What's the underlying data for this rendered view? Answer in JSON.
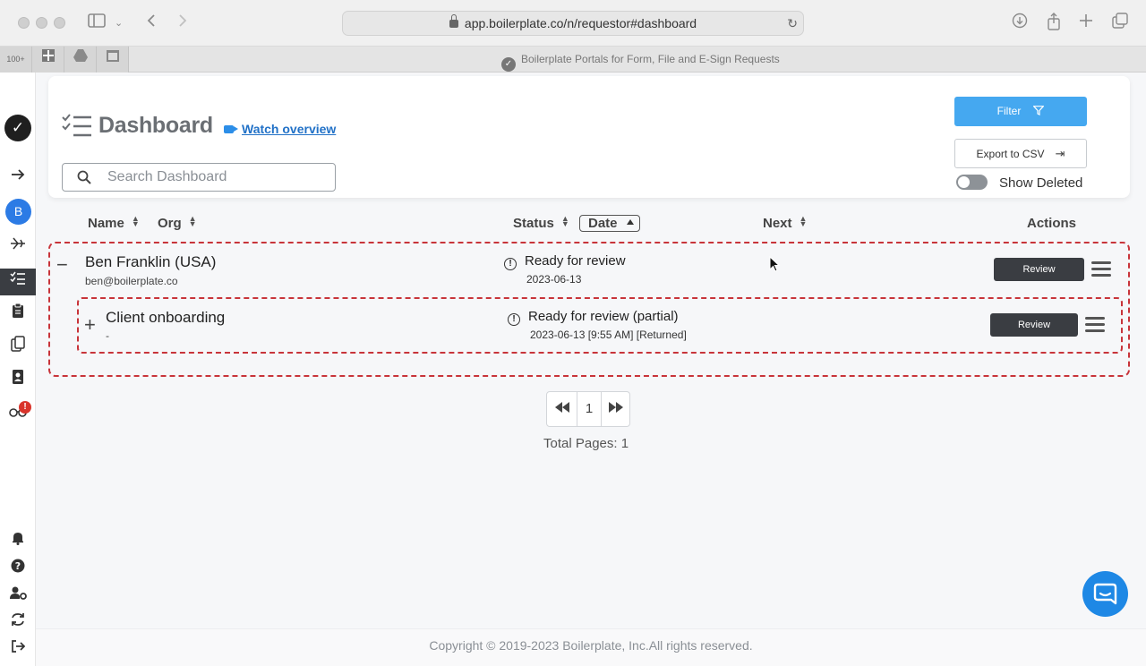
{
  "browser": {
    "url": "app.boilerplate.co/n/requestor#dashboard",
    "tab_title": "Boilerplate Portals for Form, File and E-Sign Requests",
    "pinned_tabs": [
      "100+",
      "ms",
      "drive",
      "31"
    ]
  },
  "header": {
    "title": "Dashboard",
    "watch_overview": "Watch overview",
    "search_placeholder": "Search Dashboard",
    "filter_label": "Filter",
    "export_label": "Export to CSV",
    "show_deleted_label": "Show Deleted",
    "show_deleted_on": false
  },
  "sidebar": {
    "avatar_initial": "B",
    "notification_badge": "!"
  },
  "columns": {
    "name": "Name",
    "org": "Org",
    "status": "Status",
    "date": "Date",
    "next": "Next",
    "actions": "Actions"
  },
  "rows": [
    {
      "expander": "−",
      "name": "Ben Franklin (USA)",
      "sub": "ben@boilerplate.co",
      "status": "Ready for review",
      "date": "2023-06-13",
      "action": "Review"
    },
    {
      "expander": "+",
      "name": "Client onboarding",
      "sub": "-",
      "status": "Ready for review (partial)",
      "date": "2023-06-13 [9:55 AM] [Returned]",
      "action": "Review"
    }
  ],
  "pagination": {
    "current_page": "1",
    "total_pages_text": "Total Pages: 1"
  },
  "footer": {
    "copyright": "Copyright © 2019-2023 Boilerplate, Inc.All rights reserved."
  },
  "colors": {
    "accent": "#45a8f0",
    "dark_button": "#3a3d42",
    "dashed_border": "#c8343a",
    "link": "#2171c7"
  }
}
